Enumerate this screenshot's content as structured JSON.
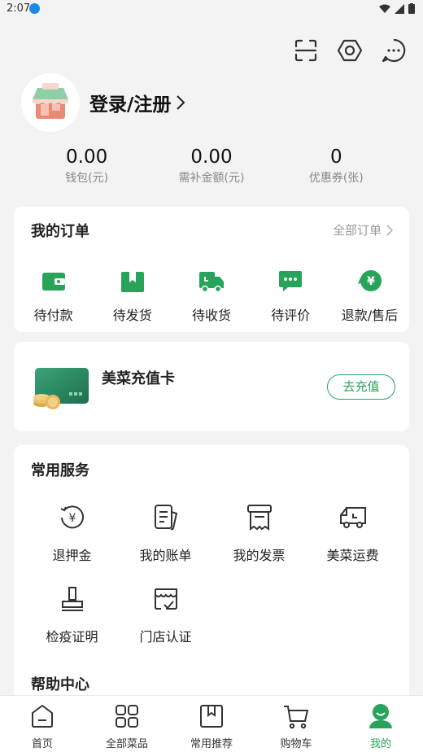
{
  "status_bar": {
    "time": "2:07"
  },
  "profile": {
    "login_label": "登录/注册"
  },
  "stats": [
    {
      "value": "0.00",
      "label": "钱包(元)"
    },
    {
      "value": "0.00",
      "label": "需补金额(元)"
    },
    {
      "value": "0",
      "label": "优惠券(张)"
    }
  ],
  "orders": {
    "title": "我的订单",
    "all_label": "全部订单",
    "items": [
      "待付款",
      "待发货",
      "待收货",
      "待评价",
      "退款/售后"
    ]
  },
  "recharge": {
    "title": "美菜充值卡",
    "button_label": "去充值"
  },
  "services": {
    "title": "常用服务",
    "items": [
      "退押金",
      "我的账单",
      "我的发票",
      "美菜运费",
      "检疫证明",
      "门店认证"
    ],
    "help_title": "帮助中心"
  },
  "tabbar": {
    "items": [
      "首页",
      "全部菜品",
      "常用推荐",
      "购物车",
      "我的"
    ],
    "active_index": 4
  },
  "colors": {
    "accent": "#27a35a",
    "background": "#f3f3f3"
  }
}
